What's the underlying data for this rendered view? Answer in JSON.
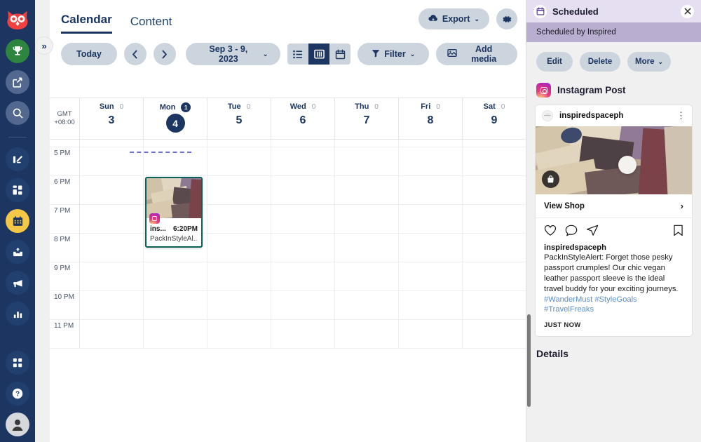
{
  "app": {
    "name": "Hootsuite"
  },
  "rail": {
    "items": [
      {
        "name": "owl-logo",
        "icon": "owl-icon"
      },
      {
        "name": "rewards",
        "icon": "trophy-icon"
      },
      {
        "name": "compose",
        "icon": "compose-icon"
      },
      {
        "name": "search",
        "icon": "search-icon"
      },
      {
        "name": "streams",
        "icon": "streams-icon"
      },
      {
        "name": "planner",
        "icon": "grid-icon"
      },
      {
        "name": "calendar",
        "icon": "calendar-icon"
      },
      {
        "name": "inbox",
        "icon": "inbox-icon"
      },
      {
        "name": "advertise",
        "icon": "megaphone-icon"
      },
      {
        "name": "analytics",
        "icon": "bar-chart-icon"
      }
    ],
    "bottom": [
      {
        "name": "apps",
        "icon": "apps-grid-icon"
      },
      {
        "name": "help",
        "icon": "question-icon"
      },
      {
        "name": "profile",
        "icon": "avatar-icon"
      }
    ],
    "collapse_label": "»"
  },
  "tabs": [
    {
      "label": "Calendar",
      "active": true
    },
    {
      "label": "Content",
      "active": false
    }
  ],
  "header_actions": {
    "export_label": "Export",
    "export_caret": "⌄",
    "settings_icon": "gear-icon"
  },
  "toolbar": {
    "today_label": "Today",
    "prev_label": "‹",
    "next_label": "›",
    "range_label": "Sep 3 - 9, 2023",
    "range_caret": "⌄",
    "views": [
      {
        "name": "list-view",
        "icon": "list-icon",
        "active": false
      },
      {
        "name": "week-view",
        "icon": "columns-icon",
        "active": true
      },
      {
        "name": "month-view",
        "icon": "calendar-icon",
        "active": false
      }
    ],
    "filter_label": "Filter",
    "filter_caret": "⌄",
    "add_media_label": "Add media"
  },
  "calendar": {
    "timezone_line1": "GMT",
    "timezone_line2": "+08:00",
    "days": [
      {
        "name": "Sun",
        "num": "3",
        "count": "0",
        "today": false,
        "badge": false
      },
      {
        "name": "Mon",
        "num": "4",
        "count": "1",
        "today": true,
        "badge": true
      },
      {
        "name": "Tue",
        "num": "5",
        "count": "0",
        "today": false,
        "badge": false
      },
      {
        "name": "Wed",
        "num": "6",
        "count": "0",
        "today": false,
        "badge": false
      },
      {
        "name": "Thu",
        "num": "7",
        "count": "0",
        "today": false,
        "badge": false
      },
      {
        "name": "Fri",
        "num": "8",
        "count": "0",
        "today": false,
        "badge": false
      },
      {
        "name": "Sat",
        "num": "9",
        "count": "0",
        "today": false,
        "badge": false
      }
    ],
    "hours": [
      "",
      "5 PM",
      "6 PM",
      "7 PM",
      "8 PM",
      "9 PM",
      "10 PM",
      "11 PM"
    ],
    "event": {
      "account": "ins...",
      "time": "6:20PM",
      "text": "PackInStyleAl...",
      "network_icon": "instagram-icon",
      "border_color": "#0b6158"
    }
  },
  "panel": {
    "title": "Scheduled",
    "title_icon": "calendar-icon",
    "close_icon": "close-icon",
    "subtitle": "Scheduled by Inspired",
    "actions": {
      "edit": "Edit",
      "delete": "Delete",
      "more": "More",
      "more_caret": "⌄"
    },
    "network": {
      "label": "Instagram Post",
      "icon": "instagram-icon"
    },
    "post": {
      "username": "inspiredspaceph",
      "menu_icon": "kebab-menu-icon",
      "shop_icon": "shopping-bag-icon",
      "view_shop_label": "View Shop",
      "view_shop_arrow": "›",
      "actions": [
        {
          "name": "like-icon"
        },
        {
          "name": "comment-icon"
        },
        {
          "name": "share-icon"
        },
        {
          "name": "bookmark-icon"
        }
      ],
      "caption_user": "inspiredspaceph",
      "caption_text": "PackInStyleAlert: Forget those pesky passport crumples! Our chic vegan leather passport sleeve is the ideal travel buddy for your exciting journeys. ",
      "caption_tags": "#WanderMust #StyleGoals #TravelFreaks",
      "timestamp": "JUST NOW"
    },
    "details_label": "Details"
  },
  "colors": {
    "rail_bg": "#1c3661",
    "accent_navy": "#1c3661",
    "active_yellow": "#f5c746",
    "panel_header": "#e6dff1",
    "panel_subheader": "#b9aecf",
    "pill_bg": "#ccd4de",
    "event_border": "#0b6158",
    "instagram_pink": "#e8397d",
    "hashtag_blue": "#5a8fc7"
  }
}
